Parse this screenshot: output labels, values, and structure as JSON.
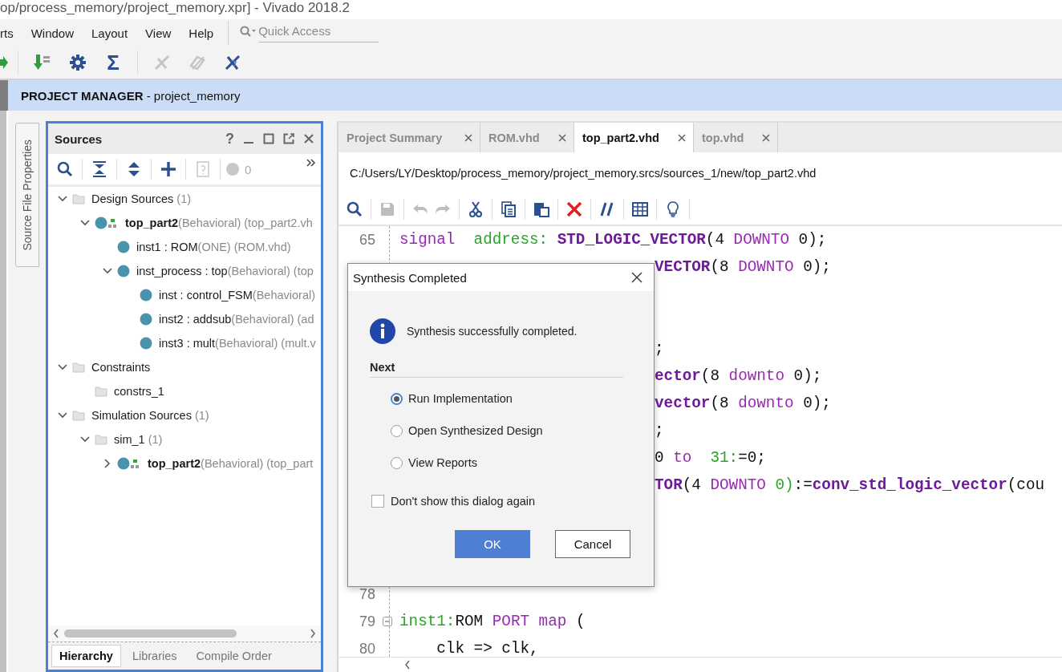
{
  "window": {
    "title": "op/process_memory/project_memory.xpr] - Vivado 2018.2"
  },
  "menu": [
    "rts",
    "Window",
    "Layout",
    "View",
    "Help"
  ],
  "quick_access": {
    "placeholder": "Quick Access"
  },
  "main_toolbar": [
    {
      "disabled": false
    },
    {
      "disabled": false
    },
    {
      "disabled": false
    },
    {
      "label": "Σ",
      "disabled": false
    },
    {
      "disabled": true
    },
    {
      "disabled": true
    },
    {
      "disabled": false
    }
  ],
  "flow_bar": {
    "title": "PROJECT MANAGER",
    "subtitle": " - project_memory"
  },
  "side_tab": {
    "label": "Source File Properties"
  },
  "sources": {
    "title": "Sources",
    "help": "?",
    "message_count": "0",
    "toolbar": [
      {
        "disabled": false
      },
      {
        "disabled": false
      },
      {
        "disabled": false
      },
      {
        "disabled": false
      },
      {
        "disabled": true
      }
    ],
    "tree": [
      {
        "kind": "folder",
        "label": "Design Sources",
        "detail": "(1)",
        "expanded": true,
        "children": [
          {
            "kind": "top",
            "label": "top_part2",
            "detail": "(Behavioral) (top_part2.vh",
            "expanded": true,
            "children": [
              {
                "kind": "module",
                "label": "inst1 : ROM",
                "detail": "(ONE) (ROM.vhd)"
              },
              {
                "kind": "module",
                "label": "inst_process : top",
                "detail": "(Behavioral) (top",
                "expanded": true,
                "children": [
                  {
                    "kind": "module",
                    "label": "inst : control_FSM",
                    "detail": "(Behavioral)"
                  },
                  {
                    "kind": "module",
                    "label": "inst2 : addsub",
                    "detail": "(Behavioral) (ad"
                  },
                  {
                    "kind": "module",
                    "label": "inst3 : mult",
                    "detail": "(Behavioral) (mult.v"
                  }
                ]
              }
            ]
          }
        ]
      },
      {
        "kind": "folder",
        "label": "Constraints",
        "expanded": true,
        "children": [
          {
            "kind": "folder",
            "label": "constrs_1"
          }
        ]
      },
      {
        "kind": "folder",
        "label": "Simulation Sources",
        "detail": "(1)",
        "expanded": true,
        "children": [
          {
            "kind": "folder",
            "label": "sim_1",
            "detail": "(1)",
            "expanded": true,
            "children": [
              {
                "kind": "top",
                "label": "top_part2",
                "detail": "(Behavioral) (top_part",
                "expanded": false
              }
            ]
          }
        ]
      }
    ],
    "tabs": [
      {
        "label": "Hierarchy",
        "selected": true
      },
      {
        "label": "Libraries",
        "selected": false
      },
      {
        "label": "Compile Order",
        "selected": false
      }
    ]
  },
  "editor": {
    "tabs": [
      {
        "label": "Project Summary",
        "selected": false
      },
      {
        "label": "ROM.vhd",
        "selected": false
      },
      {
        "label": "top_part2.vhd",
        "selected": true
      },
      {
        "label": "top.vhd",
        "selected": false
      }
    ],
    "path": "C:/Users/LY/Desktop/process_memory/project_memory.srcs/sources_1/new/top_part2.vhd",
    "toolbar": [
      {
        "disabled": false
      },
      {
        "disabled": true
      },
      {
        "disabled": true
      },
      {
        "disabled": true
      },
      {
        "disabled": false
      },
      {
        "disabled": false
      },
      {
        "disabled": false
      },
      {
        "disabled": false
      },
      {
        "disabled": false
      },
      {
        "disabled": false
      },
      {
        "disabled": false
      }
    ],
    "lines": [
      {
        "number": "65",
        "kind": "code",
        "foldable": false,
        "segments": [
          {
            "kind": "keyword",
            "text": "signal"
          },
          {
            "kind": "name",
            "text": "  address:"
          },
          {
            "kind": "type",
            "text": " STD_LOGIC_VECTOR"
          },
          {
            "kind": "plain",
            "text": "(4 "
          },
          {
            "kind": "keyword",
            "text": "DOWNTO"
          },
          {
            "kind": "plain",
            "text": " 0);"
          }
        ]
      },
      {
        "kind": "fragment",
        "foldable": false,
        "segments": [
          {
            "kind": "type",
            "text": "VECTOR"
          },
          {
            "kind": "plain",
            "text": "(8 "
          },
          {
            "kind": "keyword",
            "text": "DOWNTO"
          },
          {
            "kind": "plain",
            "text": " 0);"
          }
        ]
      },
      {
        "foldable": false
      },
      {
        "foldable": false
      },
      {
        "kind": "fragment",
        "foldable": false,
        "segments": [
          {
            "kind": "plain",
            "text": ";"
          }
        ]
      },
      {
        "kind": "fragment",
        "foldable": false,
        "segments": [
          {
            "kind": "type",
            "text": "ector"
          },
          {
            "kind": "plain",
            "text": "(8 "
          },
          {
            "kind": "keyword",
            "text": "downto"
          },
          {
            "kind": "plain",
            "text": " 0);"
          }
        ]
      },
      {
        "kind": "fragment",
        "foldable": false,
        "segments": [
          {
            "kind": "type",
            "text": "vector"
          },
          {
            "kind": "plain",
            "text": "(8 "
          },
          {
            "kind": "keyword",
            "text": "downto"
          },
          {
            "kind": "plain",
            "text": " 0);"
          }
        ]
      },
      {
        "kind": "fragment",
        "foldable": false,
        "segments": [
          {
            "kind": "plain",
            "text": ";"
          }
        ]
      },
      {
        "kind": "fragment",
        "foldable": false,
        "segments": [
          {
            "kind": "plain",
            "text": "0 "
          },
          {
            "kind": "keyword",
            "text": "to"
          },
          {
            "kind": "name",
            "text": "  31:"
          },
          {
            "kind": "plain",
            "text": "=0;"
          }
        ]
      },
      {
        "kind": "fragment",
        "foldable": false,
        "segments": [
          {
            "kind": "type",
            "text": "TOR"
          },
          {
            "kind": "plain",
            "text": "(4 "
          },
          {
            "kind": "keyword",
            "text": "DOWNTO"
          },
          {
            "kind": "name",
            "text": " 0)"
          },
          {
            "kind": "plain",
            "text": ":="
          },
          {
            "kind": "type",
            "text": "conv_std_logic_vector"
          },
          {
            "kind": "plain",
            "text": "(cou"
          }
        ]
      },
      {
        "foldable": false
      },
      {
        "foldable": false
      },
      {
        "foldable": false
      },
      {
        "number": "78",
        "foldable": false
      },
      {
        "number": "79",
        "kind": "code",
        "foldable": true,
        "segments": [
          {
            "kind": "name",
            "text": "inst1:"
          },
          {
            "kind": "plain",
            "text": "ROM "
          },
          {
            "kind": "keyword",
            "text": "PORT map"
          },
          {
            "kind": "plain",
            "text": " ("
          }
        ]
      },
      {
        "number": "80",
        "kind": "code",
        "foldable": false,
        "segments": [
          {
            "kind": "plain",
            "text": "    clk => clk,"
          }
        ]
      }
    ]
  },
  "dialog": {
    "title": "Synthesis Completed",
    "message": "Synthesis successfully completed.",
    "section": "Next",
    "options": [
      {
        "label": "Run Implementation",
        "selected": true
      },
      {
        "label": "Open Synthesized Design",
        "selected": false
      },
      {
        "label": "View Reports",
        "selected": false
      }
    ],
    "dont_show": {
      "label": "Don't show this dialog again",
      "checked": false
    },
    "buttons": [
      {
        "label": "OK",
        "kind": "primary"
      },
      {
        "label": "Cancel",
        "kind": "secondary"
      }
    ]
  }
}
